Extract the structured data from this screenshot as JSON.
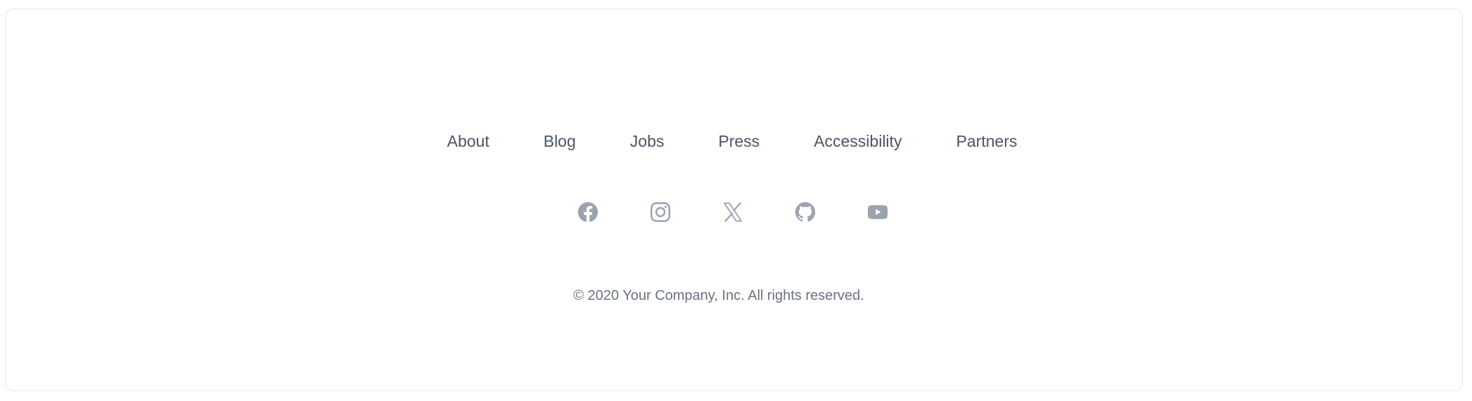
{
  "footer": {
    "nav_links": [
      {
        "label": "About"
      },
      {
        "label": "Blog"
      },
      {
        "label": "Jobs"
      },
      {
        "label": "Press"
      },
      {
        "label": "Accessibility"
      },
      {
        "label": "Partners"
      }
    ],
    "social_icons": [
      {
        "icon": "facebook-icon",
        "label": "Facebook"
      },
      {
        "icon": "instagram-icon",
        "label": "Instagram"
      },
      {
        "icon": "x-icon",
        "label": "X"
      },
      {
        "icon": "github-icon",
        "label": "GitHub"
      },
      {
        "icon": "youtube-icon",
        "label": "YouTube"
      }
    ],
    "copyright": "© 2020 Your Company, Inc. All rights reserved."
  },
  "colors": {
    "link_text": "#4b5563",
    "icon": "#9ca3af",
    "copyright_text": "#6b7280",
    "border": "#e5e7eb",
    "background": "#ffffff"
  }
}
